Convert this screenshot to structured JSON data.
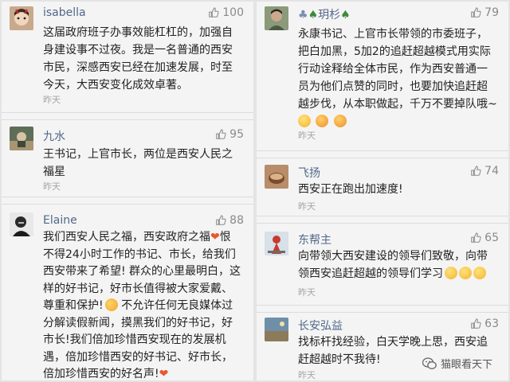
{
  "left_column": [
    {
      "username": "isabella",
      "likes": "100",
      "lines": [
        "这届政府班子办事效能杠杠的，加强自",
        "身建设事不过夜。我是一名普通的西安",
        "市民，深感西安已经在加速发展，时至",
        "今天，大西安变化成效卓著。"
      ],
      "time": "昨天"
    },
    {
      "username": "九水",
      "likes": "95",
      "lines": [
        "王书记，上官市长，两位是西安人民之",
        "福星"
      ],
      "time": "昨天"
    },
    {
      "username": "Elaine",
      "likes": "88",
      "lines": [
        "我们西安人民之福，西安政府之福",
        "不得24小时工作的书记、市长，给我们",
        "西安带来了希望! 群众的心里最明白，这",
        "样的好书记，好市长值得被大家爱戴、",
        "尊重和保护!",
        "分解读假新闻，摸黑我们的好书记，好",
        "市长!我们倍加珍惜西安现在的发展机",
        "遇，倍加珍惜西安的好书记、好市长，",
        "倍加珍惜西安的好名声!"
      ],
      "line_suffixes": [
        "恨",
        "",
        "",
        "",
        " 不允许任何无良媒体过",
        "",
        "",
        "",
        ""
      ],
      "time": ""
    }
  ],
  "right_column": [
    {
      "username": "玥杉",
      "likes": "79",
      "lines": [
        "永康书记、上官市长带领的市委班子，",
        "把白加黑，5加2的追赶超越模式用实际",
        "行动诠释给全体市民，作为西安普通一",
        "员为他们点赞的同时，也要加快追赶超",
        "越步伐，从本职做起，千万不要掉队哦~"
      ],
      "time": "昨天"
    },
    {
      "username": "飞扬",
      "likes": "74",
      "lines": [
        "西安正在跑出加速度!"
      ],
      "time": "昨天"
    },
    {
      "username": "东帮主",
      "likes": "65",
      "lines": [
        "向带领大西安建设的领导们致敬，向带",
        "领西安追赶超越的领导们学习"
      ],
      "time": "昨天"
    },
    {
      "username": "长安弘益",
      "likes": "63",
      "lines": [
        "找标杆找经验，白天学晚上思，西安追",
        "赶超越时不我待!"
      ],
      "time": "昨天"
    }
  ],
  "watermark": "猫眼看天下",
  "colors": {
    "username": "#50688a",
    "text": "#222222",
    "meta": "#a5a5a5",
    "background": "#f4f4f4",
    "heart": "#e9572d"
  },
  "icons": [
    "thumbs-up-icon",
    "heart-emoji-icon",
    "fist-emoji-icon",
    "smile-emoji-icon",
    "tree-emoji-icon",
    "wechat-icon"
  ]
}
